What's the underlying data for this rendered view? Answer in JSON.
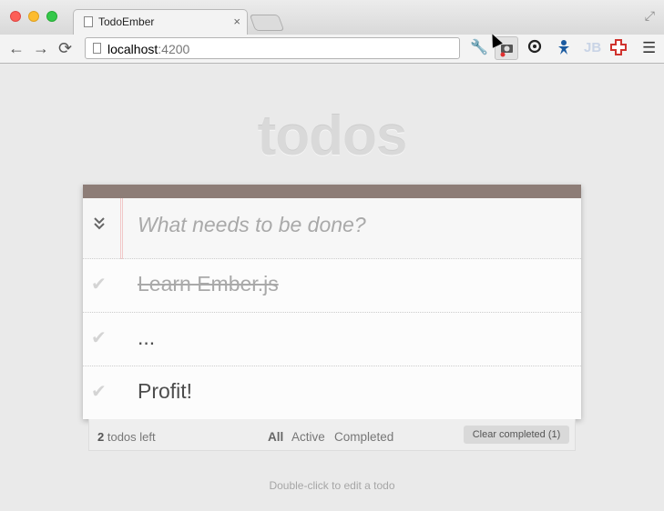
{
  "browser": {
    "tab_title": "TodoEmber",
    "tab_close_glyph": "×",
    "url_host": "localhost",
    "url_port": ":4200",
    "nav": {
      "back_glyph": "←",
      "forward_glyph": "→",
      "reload_glyph": "⟳"
    }
  },
  "app": {
    "title": "todos",
    "toggle_all_glyph": "»",
    "new_todo_placeholder": "What needs to be done?",
    "check_glyph": "✔",
    "todos": [
      {
        "label": "Learn Ember.js",
        "completed": true
      },
      {
        "label": "...",
        "completed": false
      },
      {
        "label": "Profit!",
        "completed": false
      }
    ],
    "footer": {
      "count_number": "2",
      "count_text": " todos left",
      "filters": [
        "All",
        "Active",
        "Completed"
      ],
      "clear_label": "Clear completed (1)"
    },
    "info": "Double-click to edit a todo"
  },
  "colors": {
    "header_bar": "#8d7d77",
    "title": "rgba(0,0,0,0.12)"
  }
}
